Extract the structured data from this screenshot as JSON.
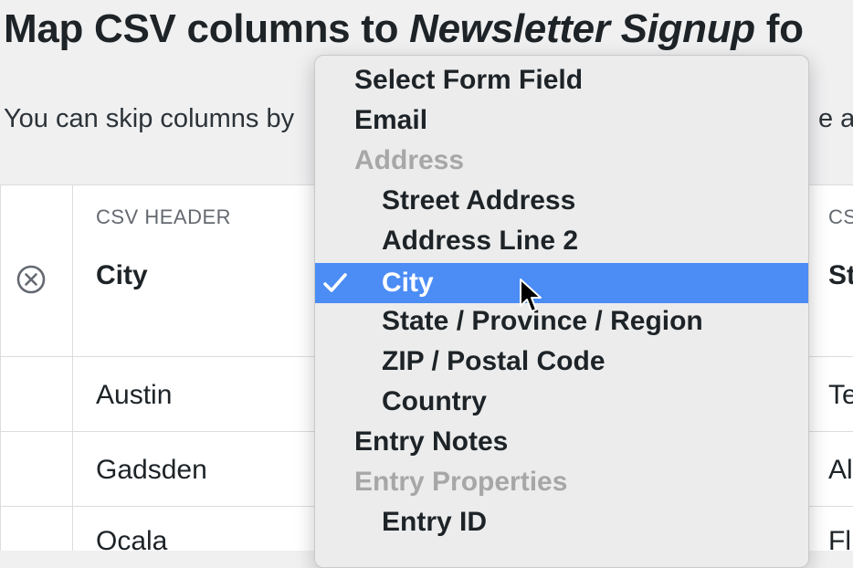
{
  "header": {
    "title_prefix": "Map CSV columns to ",
    "form_name": "Newsletter Signup",
    "title_suffix": " fo"
  },
  "intro": {
    "left": "You can skip columns by",
    "right": "e a n"
  },
  "table": {
    "col1": {
      "label": "CSV HEADER",
      "name": "City",
      "values": [
        "Austin",
        "Gadsden",
        "Ocala"
      ]
    },
    "col2": {
      "label": "CS",
      "name": "St",
      "values": [
        "Te",
        "Al",
        "Fl"
      ]
    }
  },
  "icons": {
    "skip": "close-circle-icon",
    "check": "checkmark-icon",
    "cursor": "mouse-pointer-icon"
  },
  "colors": {
    "selected": "#4b8cf5",
    "group_label": "#a7a7a7",
    "background": "#f0f0f1"
  },
  "dropdown": {
    "options": [
      {
        "label": "Select Form Field",
        "kind": "option"
      },
      {
        "label": "Email",
        "kind": "option"
      },
      {
        "label": "Address",
        "kind": "group"
      },
      {
        "label": "Street Address",
        "kind": "sub"
      },
      {
        "label": "Address Line 2",
        "kind": "sub"
      },
      {
        "label": "City",
        "kind": "sub",
        "selected": true
      },
      {
        "label": "State / Province / Region",
        "kind": "sub"
      },
      {
        "label": "ZIP / Postal Code",
        "kind": "sub"
      },
      {
        "label": "Country",
        "kind": "sub"
      },
      {
        "label": "Entry Notes",
        "kind": "option"
      },
      {
        "label": "Entry Properties",
        "kind": "group"
      },
      {
        "label": "Entry ID",
        "kind": "sub"
      }
    ]
  }
}
